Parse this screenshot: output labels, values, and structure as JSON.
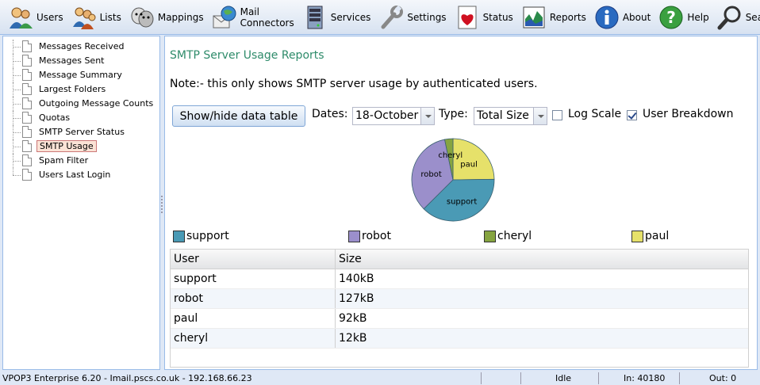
{
  "toolbar": {
    "items": [
      {
        "label": "Users",
        "icon": "users-icon"
      },
      {
        "label": "Lists",
        "icon": "lists-icon"
      },
      {
        "label": "Mappings",
        "icon": "mappings-icon"
      },
      {
        "label": "Mail Connectors",
        "icon": "mail-connectors-icon"
      },
      {
        "label": "Services",
        "icon": "services-icon"
      },
      {
        "label": "Settings",
        "icon": "settings-icon"
      },
      {
        "label": "Status",
        "icon": "status-icon"
      },
      {
        "label": "Reports",
        "icon": "reports-icon"
      },
      {
        "label": "About",
        "icon": "about-icon"
      },
      {
        "label": "Help",
        "icon": "help-icon"
      },
      {
        "label": "Search",
        "icon": "search-icon"
      }
    ]
  },
  "tree": {
    "items": [
      {
        "label": "Messages Received"
      },
      {
        "label": "Messages Sent"
      },
      {
        "label": "Message Summary"
      },
      {
        "label": "Largest Folders"
      },
      {
        "label": "Outgoing Message Counts"
      },
      {
        "label": "Quotas"
      },
      {
        "label": "SMTP Server Status"
      },
      {
        "label": "SMTP Usage",
        "selected": true
      },
      {
        "label": "Spam Filter"
      },
      {
        "label": "Users Last Login"
      }
    ]
  },
  "main": {
    "title": "SMTP Server Usage Reports",
    "note": "Note:- this only shows SMTP server usage by authenticated users.",
    "show_hide_label": "Show/hide data table",
    "dates_label": "Dates:",
    "dates_value": "18-October",
    "type_label": "Type:",
    "type_value": "Total Size",
    "log_scale_label": "Log Scale",
    "log_scale_checked": false,
    "user_breakdown_label": "User Breakdown",
    "user_breakdown_checked": true
  },
  "chart_data": {
    "type": "pie",
    "slices": [
      {
        "name": "support",
        "value": 140,
        "color": "#4a9ab5"
      },
      {
        "name": "robot",
        "value": 127,
        "color": "#9b8fcb"
      },
      {
        "name": "cheryl",
        "value": 12,
        "color": "#86a440"
      },
      {
        "name": "paul",
        "value": 92,
        "color": "#e6e16a"
      }
    ],
    "legend_position": "bottom"
  },
  "table": {
    "headers": [
      "User",
      "Size"
    ],
    "rows": [
      [
        "support",
        "140kB"
      ],
      [
        "robot",
        "127kB"
      ],
      [
        "paul",
        "92kB"
      ],
      [
        "cheryl",
        "12kB"
      ]
    ]
  },
  "statusbar": {
    "server": "VPOP3 Enterprise 6.20 - Imail.pscs.co.uk - 192.168.66.23",
    "state": "Idle",
    "in": "In: 40180",
    "out": "Out: 0"
  }
}
